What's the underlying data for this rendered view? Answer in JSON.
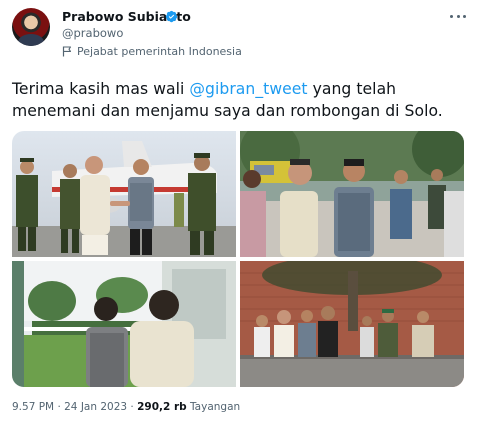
{
  "tweet": {
    "author_name": "Prabowo Subianto",
    "handle": "@prabowo",
    "affiliation": "Pejabat pemerintah Indonesia",
    "text_before": "Terima kasih mas wali ",
    "mention": "@gibran_tweet",
    "text_after": " yang telah menemani dan menjamu saya dan rombongan di Solo.",
    "time": "9.57 PM",
    "separator": " · ",
    "date": "24 Jan 2023",
    "views_count": "290,2 rb",
    "views_label": "Tayangan"
  },
  "icons": {
    "verified": "verified-badge-icon",
    "affiliation": "flag-icon",
    "more": "more-options-icon"
  },
  "colors": {
    "accent": "#1d9bf0",
    "text": "#0f1419",
    "secondary": "#536471"
  }
}
